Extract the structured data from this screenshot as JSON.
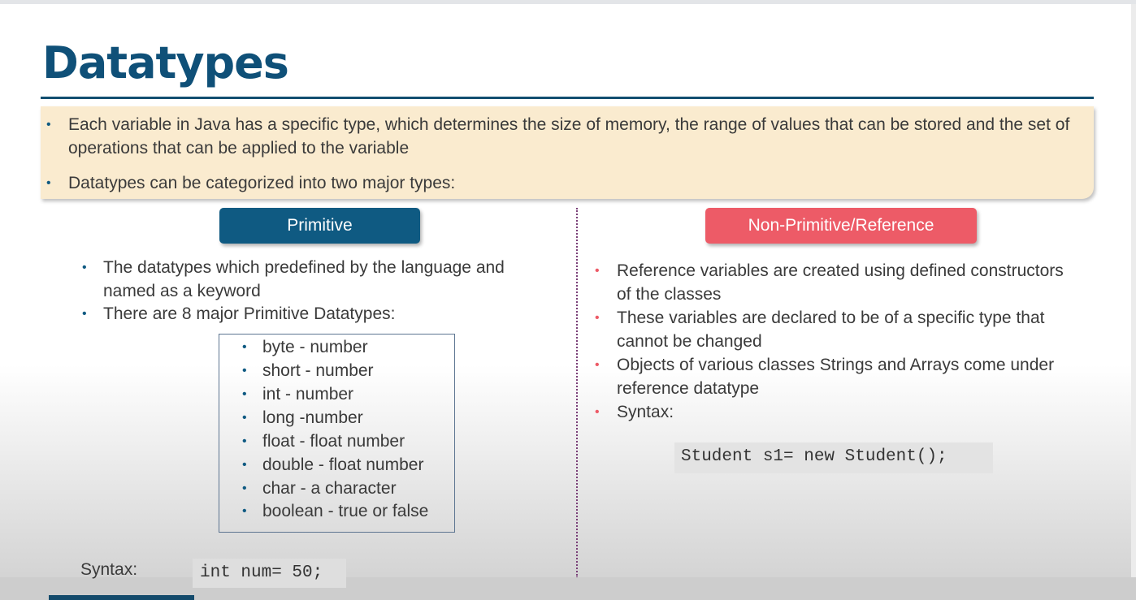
{
  "slide": {
    "title": "Datatypes",
    "intro_bullets": [
      "Each variable in Java has a specific type, which determines the size of memory, the range of values that can be stored and the set of",
      "operations that can be applied to the variable",
      "Datatypes can be categorized into two major types:"
    ],
    "primitive": {
      "label": "Primitive",
      "bullets": [
        "The datatypes which predefined by the language and",
        "named as a keyword",
        "There are 8 major Primitive Datatypes:"
      ],
      "types": [
        "byte - number",
        "short - number",
        "int - number",
        "long -number",
        "float - float number",
        "double - float number",
        "char - a character",
        "boolean - true or false"
      ],
      "syntax_label": "Syntax:",
      "syntax_code": "int num= 50;"
    },
    "reference": {
      "label": "Non-Primitive/Reference",
      "bullets": [
        "Reference variables are created using defined constructors",
        "of the classes",
        "These variables are declared to be of a specific type that",
        "cannot be changed",
        "Objects of various classes Strings and Arrays come under",
        "reference datatype",
        "Syntax:"
      ],
      "syntax_code": "Student s1= new Student();"
    }
  },
  "colors": {
    "title": "#0f5078",
    "primitive_pill": "#0f5a82",
    "reference_pill": "#ed5b67",
    "intro_box": "#faebcf",
    "primitive_bullet": "#0f5a82",
    "reference_bullet": "#ed5b67"
  }
}
